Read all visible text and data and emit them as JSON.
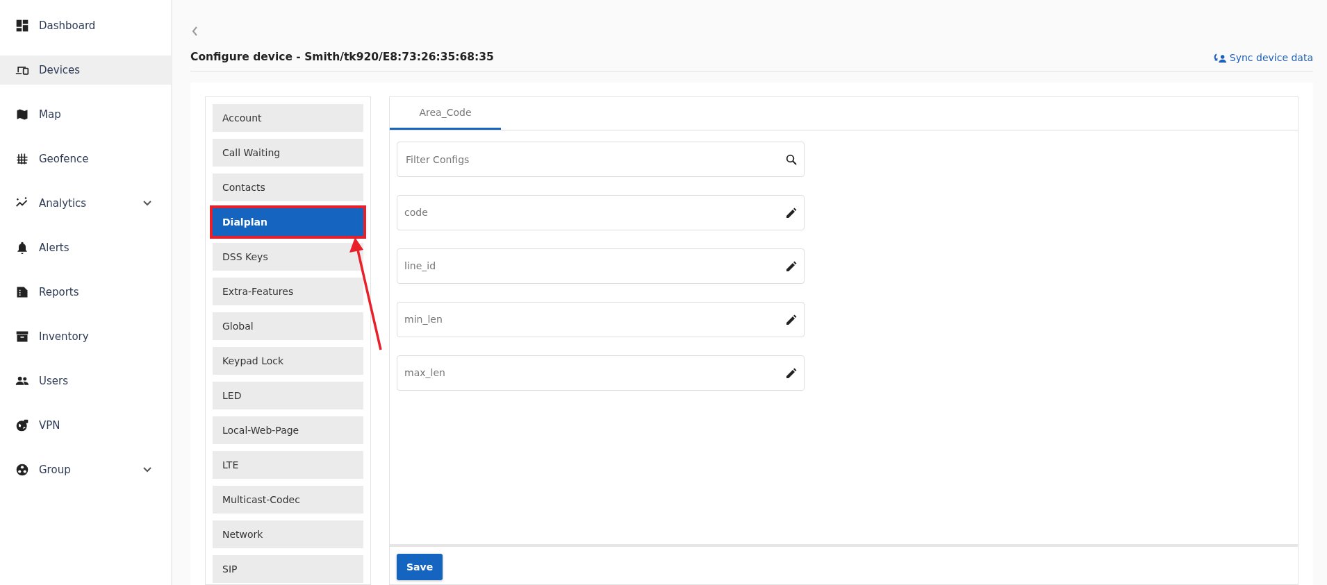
{
  "sidebar": {
    "items": [
      {
        "label": "Dashboard",
        "selected": false,
        "expandable": false
      },
      {
        "label": "Devices",
        "selected": true,
        "expandable": false
      },
      {
        "label": "Map",
        "selected": false,
        "expandable": false
      },
      {
        "label": "Geofence",
        "selected": false,
        "expandable": false
      },
      {
        "label": "Analytics",
        "selected": false,
        "expandable": true
      },
      {
        "label": "Alerts",
        "selected": false,
        "expandable": false
      },
      {
        "label": "Reports",
        "selected": false,
        "expandable": false
      },
      {
        "label": "Inventory",
        "selected": false,
        "expandable": false
      },
      {
        "label": "Users",
        "selected": false,
        "expandable": false
      },
      {
        "label": "VPN",
        "selected": false,
        "expandable": false
      },
      {
        "label": "Group",
        "selected": false,
        "expandable": true
      }
    ]
  },
  "header": {
    "title": "Configure device - Smith/tk920/E8:73:26:35:68:35",
    "sync_link": "Sync device data"
  },
  "config_sections": [
    {
      "label": "Account",
      "selected": false,
      "highlighted": false
    },
    {
      "label": "Call Waiting",
      "selected": false,
      "highlighted": false
    },
    {
      "label": "Contacts",
      "selected": false,
      "highlighted": false
    },
    {
      "label": "Dialplan",
      "selected": true,
      "highlighted": true
    },
    {
      "label": "DSS Keys",
      "selected": false,
      "highlighted": false
    },
    {
      "label": "Extra-Features",
      "selected": false,
      "highlighted": false
    },
    {
      "label": "Global",
      "selected": false,
      "highlighted": false
    },
    {
      "label": "Keypad Lock",
      "selected": false,
      "highlighted": false
    },
    {
      "label": "LED",
      "selected": false,
      "highlighted": false
    },
    {
      "label": "Local-Web-Page",
      "selected": false,
      "highlighted": false
    },
    {
      "label": "LTE",
      "selected": false,
      "highlighted": false
    },
    {
      "label": "Multicast-Codec",
      "selected": false,
      "highlighted": false
    },
    {
      "label": "Network",
      "selected": false,
      "highlighted": false
    },
    {
      "label": "SIP",
      "selected": false,
      "highlighted": false
    }
  ],
  "tabs": [
    {
      "label": "Area_Code",
      "selected": true
    }
  ],
  "filter": {
    "placeholder": "Filter Configs"
  },
  "fields": [
    {
      "label": "code"
    },
    {
      "label": "line_id"
    },
    {
      "label": "min_len"
    },
    {
      "label": "max_len"
    }
  ],
  "buttons": [
    "Save"
  ]
}
